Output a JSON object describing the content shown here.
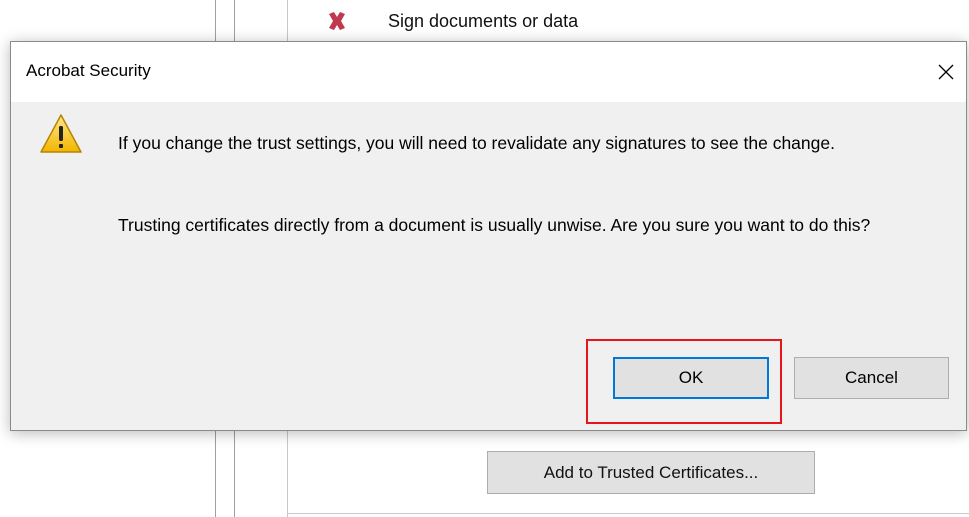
{
  "background": {
    "sign_row_label": "Sign documents or data",
    "add_trusted_button_label": "Add to Trusted Certificates...",
    "x_icon": "red-x-icon"
  },
  "dialog": {
    "title": "Acrobat Security",
    "close_icon": "close-icon",
    "warning_icon": "warning-triangle-icon",
    "message_1": "If you change the trust settings, you will need to revalidate any signatures to see the change.",
    "message_2": "Trusting certificates directly from a document is usually unwise. Are you sure you want to do this?",
    "ok_label": "OK",
    "cancel_label": "Cancel"
  },
  "colors": {
    "highlight": "#e8141c",
    "focus_border": "#0078d7",
    "dialog_bg": "#f0f0f0"
  }
}
